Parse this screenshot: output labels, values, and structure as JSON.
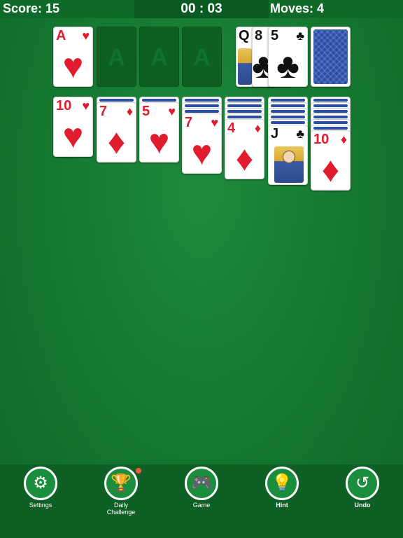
{
  "header": {
    "score_label": "Score:",
    "score_value": "15",
    "timer": "00 : 03",
    "moves_label": "Moves:",
    "moves_value": "4"
  },
  "foundations": [
    {
      "rank": "A",
      "suit": "♥",
      "color": "red"
    },
    {
      "empty_label": "A"
    },
    {
      "empty_label": "A"
    },
    {
      "empty_label": "A"
    }
  ],
  "waste": [
    {
      "rank": "Q",
      "suit": "♥",
      "color": "black"
    },
    {
      "rank": "8",
      "suit": "♣",
      "color": "black"
    },
    {
      "rank": "5",
      "suit": "♣",
      "color": "black"
    }
  ],
  "tableau": [
    {
      "face_down": 0,
      "rank": "10",
      "suit": "♥",
      "color": "red"
    },
    {
      "face_down": 1,
      "rank": "7",
      "suit": "♦",
      "color": "red"
    },
    {
      "face_down": 1,
      "rank": "5",
      "suit": "♥",
      "color": "red"
    },
    {
      "face_down": 3,
      "rank": "7",
      "suit": "♥",
      "color": "red"
    },
    {
      "face_down": 4,
      "rank": "4",
      "suit": "♦",
      "color": "red"
    },
    {
      "face_down": 5,
      "rank": "J",
      "suit": "♣",
      "color": "black"
    },
    {
      "face_down": 6,
      "rank": "10",
      "suit": "♦",
      "color": "red"
    }
  ],
  "toolbar": {
    "settings": {
      "label": "Settings",
      "icon": "gear-icon",
      "glyph": "⚙"
    },
    "daily": {
      "label_line1": "Daily",
      "label_line2": "Challenge",
      "icon": "trophy-icon",
      "glyph": "🏆"
    },
    "game": {
      "label": "Game",
      "icon": "gamepad-icon",
      "glyph": "🎮"
    },
    "hint": {
      "label": "Hint",
      "icon": "lightbulb-icon",
      "glyph": "💡"
    },
    "undo": {
      "label": "Undo",
      "icon": "undo-icon",
      "glyph": "↺"
    }
  },
  "colors": {
    "felt": "#157a32",
    "red_suit": "#e01c2e",
    "card_back": "#2b4fa8"
  }
}
